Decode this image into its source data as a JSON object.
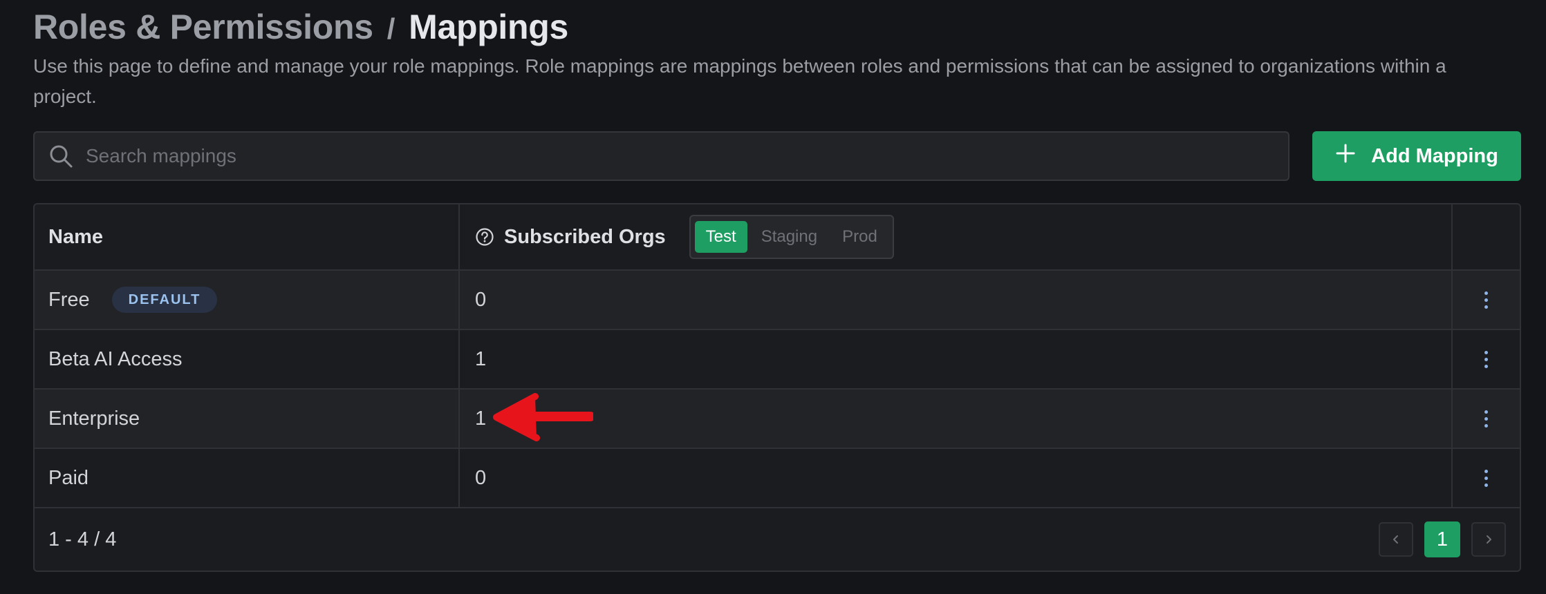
{
  "header": {
    "breadcrumb_parent": "Roles & Permissions",
    "breadcrumb_separator": "/",
    "title": "Mappings",
    "description": "Use this page to define and manage your role mappings. Role mappings are mappings between roles and permissions that can be assigned to organizations within a project."
  },
  "search": {
    "placeholder": "Search mappings",
    "value": "",
    "icon": "search-icon"
  },
  "add_button": {
    "label": "Add Mapping",
    "icon": "plus-icon"
  },
  "table": {
    "columns": {
      "name": "Name",
      "subscribed_orgs": "Subscribed Orgs"
    },
    "environments": [
      "Test",
      "Staging",
      "Prod"
    ],
    "active_environment": "Test",
    "rows": [
      {
        "name": "Free",
        "badge": "DEFAULT",
        "subscribed_orgs": "0"
      },
      {
        "name": "Beta AI Access",
        "badge": "",
        "subscribed_orgs": "1"
      },
      {
        "name": "Enterprise",
        "badge": "",
        "subscribed_orgs": "1"
      },
      {
        "name": "Paid",
        "badge": "",
        "subscribed_orgs": "0"
      }
    ]
  },
  "pagination": {
    "range": "1 - 4 / 4",
    "current_page": "1"
  },
  "colors": {
    "background": "#141518",
    "accent": "#1f9e63",
    "badge_bg": "#283244",
    "badge_text": "#9cc3f0",
    "annotation_arrow": "#e8141c"
  }
}
